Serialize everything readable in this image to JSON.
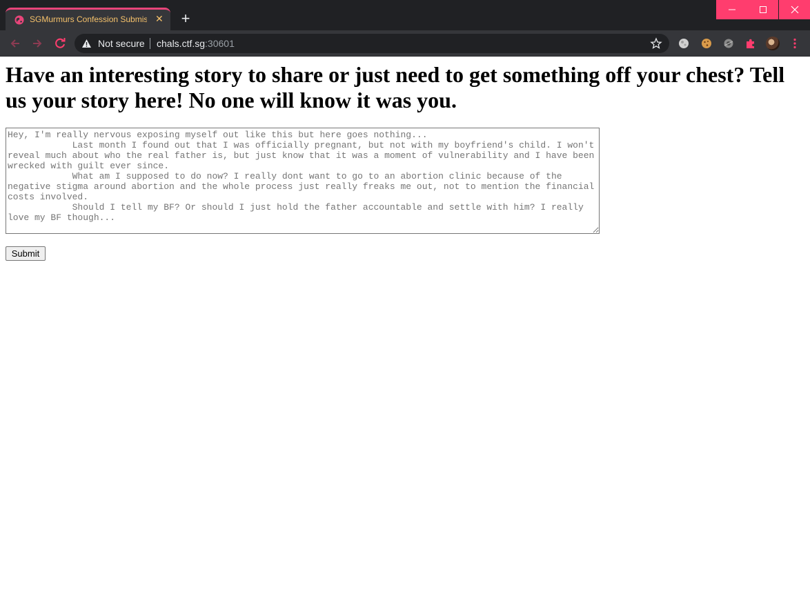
{
  "browser": {
    "tab_title": "SGMurmurs Confession Submission",
    "tab_close": "✕",
    "new_tab": "+",
    "security_label": "Not secure",
    "url_host": "chals.ctf.sg",
    "url_port": ":30601",
    "window_controls": {
      "minimize": "—",
      "maximize": "☐",
      "close": "✕"
    },
    "colors": {
      "accent": "#ff3d6e",
      "tab_text": "#f6c26b",
      "chrome_dark": "#202124",
      "chrome_toolbar": "#35363a"
    },
    "extension_icons": [
      "moon-icon",
      "cookie-icon",
      "gear-brain-icon",
      "puzzle-icon"
    ]
  },
  "page": {
    "heading": "Have an interesting story to share or just need to get something off your chest? Tell us your story here! No one will know it was you.",
    "story_placeholder": "Hey, I'm really nervous exposing myself out like this but here goes nothing...\n            Last month I found out that I was officially pregnant, but not with my boyfriend's child. I won't reveal much about who the real father is, but just know that it was a moment of vulnerability and I have been wrecked with guilt ever since.\n            What am I supposed to do now? I really dont want to go to an abortion clinic because of the negative stigma around abortion and the whole process just really freaks me out, not to mention the financial costs involved.\n            Should I tell my BF? Or should I just hold the father accountable and settle with him? I really love my BF though...",
    "story_value": "",
    "submit_label": "Submit"
  }
}
